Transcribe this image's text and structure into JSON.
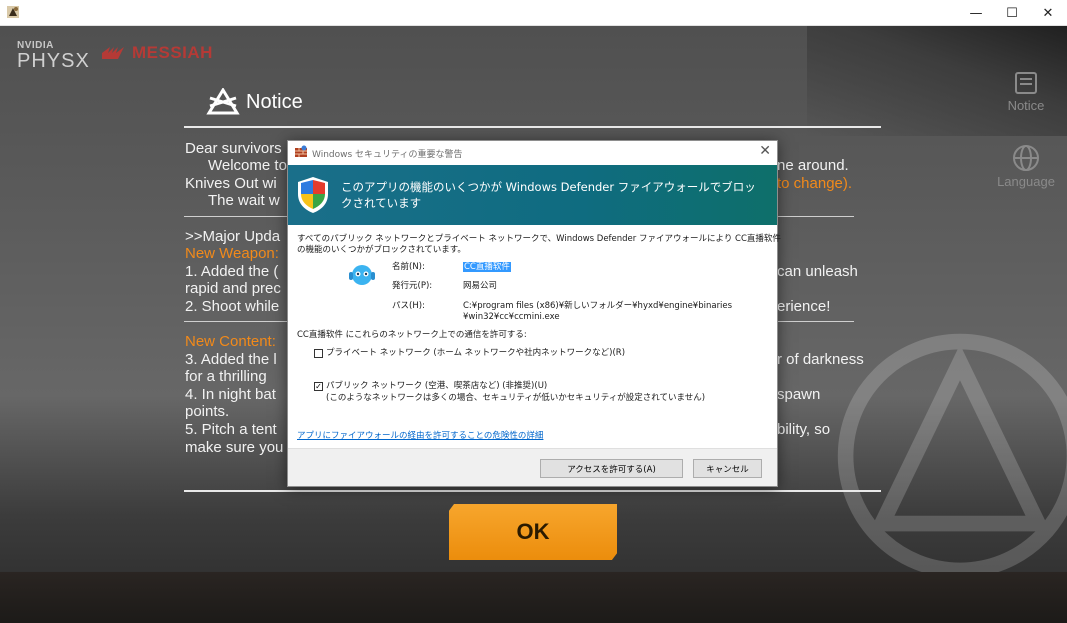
{
  "window": {
    "minimize_glyph": "—",
    "maximize_glyph": "☐",
    "close_glyph": "✕"
  },
  "logos": {
    "nvidia": "NVIDIA",
    "physx": "PHYSX",
    "messiah": "MESSIAH"
  },
  "side_menu": [
    {
      "label": "Notice",
      "icon": "notice-icon"
    },
    {
      "label": "Language",
      "icon": "globe-icon"
    }
  ],
  "notice": {
    "title": "Notice",
    "lines": [
      {
        "text": "Dear survivors",
        "style": "white"
      },
      {
        "text": "Welcome to",
        "style": "white"
      },
      {
        "text": "ne around.",
        "style": "white"
      },
      {
        "text": "Knives Out wi",
        "style": "white"
      },
      {
        "text": "to change).",
        "style": "orange"
      },
      {
        "text": "The wait w",
        "style": "white"
      },
      {
        "text": ">>Major Upda",
        "style": "white"
      },
      {
        "text": "New Weapon:",
        "style": "orange"
      },
      {
        "text": "1. Added the (",
        "style": "white"
      },
      {
        "text": "can unleash",
        "style": "white"
      },
      {
        "text": "rapid and prec",
        "style": "white"
      },
      {
        "text": "2. Shoot while",
        "style": "white"
      },
      {
        "text": "erience!",
        "style": "white"
      },
      {
        "text": "New Content:",
        "style": "orange"
      },
      {
        "text": "3. Added the l",
        "style": "white"
      },
      {
        "text": "r of darkness",
        "style": "white"
      },
      {
        "text": "for a thrilling",
        "style": "white"
      },
      {
        "text": "4. In night bat",
        "style": "white"
      },
      {
        "text": "spawn",
        "style": "white"
      },
      {
        "text": "points.",
        "style": "white"
      },
      {
        "text": "5. Pitch a tent",
        "style": "white"
      },
      {
        "text": "bility, so",
        "style": "white"
      },
      {
        "text": "make sure you",
        "style": "white"
      }
    ],
    "ok_label": "OK"
  },
  "dialog": {
    "title": "Windows セキュリティの重要な警告",
    "close_glyph": "✕",
    "headline": "このアプリの機能のいくつかが Windows Defender ファイアウォールでブロックされています",
    "description_line1": "すべてのパブリック ネットワークとプライベート ネットワークで、Windows Defender ファイアウォールにより CC直播软件",
    "description_line2": "の機能のいくつかがブロックされています。",
    "name_label": "名前(N):",
    "name_value": "CC直播软件",
    "publisher_label": "発行元(P):",
    "publisher_value": "网易公司",
    "path_label": "パス(H):",
    "path_value_line1": "C:¥program files (x86)¥新しいフォルダー¥hyxd¥engine¥binaries",
    "path_value_line2": "¥win32¥cc¥ccmini.exe",
    "allow_prompt": "CC直播软件 にこれらのネットワーク上での通信を許可する:",
    "private_network": {
      "label": "プライベート ネットワーク (ホーム ネットワークや社内ネットワークなど)(R)",
      "checked": false
    },
    "public_network": {
      "label": "パブリック ネットワーク (空港、喫茶店など) (非推奨)(U)",
      "sublabel": "(このようなネットワークは多くの場合、セキュリティが低いかセキュリティが設定されていません)",
      "checked": true
    },
    "risk_link": "アプリにファイアウォールの経由を許可することの危険性の詳細",
    "allow_button": "アクセスを許可する(A)",
    "cancel_button": "キャンセル"
  }
}
